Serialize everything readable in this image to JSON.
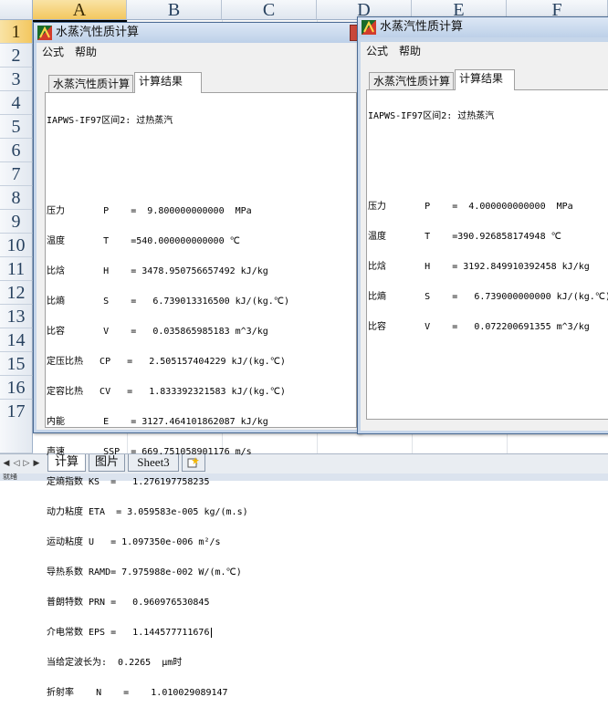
{
  "spreadsheet": {
    "columns": [
      "A",
      "B",
      "C",
      "D",
      "E",
      "F"
    ],
    "rows": [
      "1",
      "2",
      "3",
      "4",
      "5",
      "6",
      "7",
      "8",
      "9",
      "10",
      "11",
      "12",
      "13",
      "14",
      "15",
      "16",
      "17"
    ],
    "sheet_tabs": [
      "计算",
      "图片",
      "Sheet3"
    ],
    "status_text": "就绪"
  },
  "window_left": {
    "title": "水蒸汽性质计算",
    "menu": [
      "公式",
      "帮助"
    ],
    "tabs": [
      "水蒸汽性质计算",
      "计算结果"
    ],
    "lines": [
      "IAPWS-IF97区间2: 过热蒸汽",
      "",
      "",
      "压力       P    =  9.800000000000  MPa",
      "温度       T    =540.000000000000 ℃",
      "比焓       H    = 3478.950756657492 kJ/kg",
      "比熵       S    =   6.739013316500 kJ/(kg.℃)",
      "比容       V    =   0.035865985183 m^3/kg",
      "定压比热   CP   =   2.505157404229 kJ/(kg.℃)",
      "定容比热   CV   =   1.833392321583 kJ/(kg.℃)",
      "内能       E    = 3127.464101862087 kJ/kg",
      "声速       SSP  = 669.751058901176 m/s",
      "定熵指数 KS  =   1.276197758235",
      "动力粘度 ETA  = 3.059583e-005 kg/(m.s)",
      "运动粘度 U   = 1.097350e-006 m²/s",
      "导热系数 RAMD= 7.975988e-002 W/(m.℃)",
      "普朗特数 PRN =   0.960976530845",
      "介电常数 EPS =   1.144577711676",
      "当给定波长为:  0.2265  μm时",
      "折射率    N    =    1.010029089147"
    ]
  },
  "window_right": {
    "title": "水蒸汽性质计算",
    "menu": [
      "公式",
      "帮助"
    ],
    "tabs": [
      "水蒸汽性质计算",
      "计算结果"
    ],
    "lines": [
      "IAPWS-IF97区间2: 过热蒸汽",
      "",
      "",
      "压力       P    =  4.000000000000  MPa",
      "温度       T    =390.926858174948 ℃",
      "比焓       H    = 3192.849910392458 kJ/kg",
      "比熵       S    =   6.739000000000 kJ/(kg.℃)",
      "比容       V    =   0.072200691355 m^3/kg"
    ]
  }
}
